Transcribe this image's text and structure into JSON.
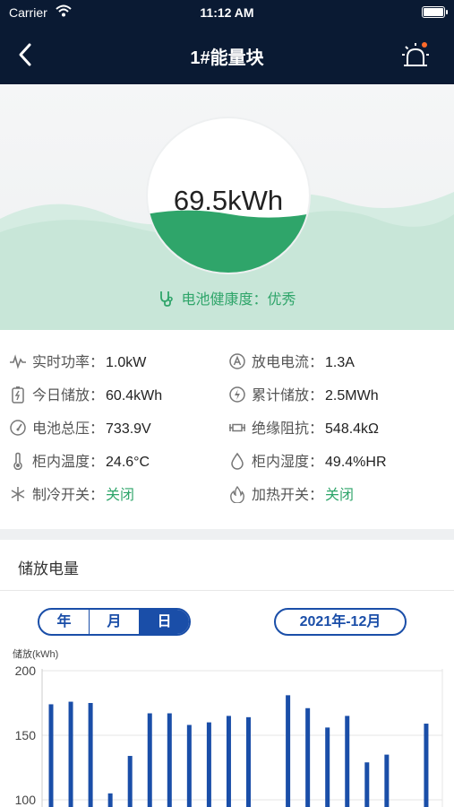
{
  "status_bar": {
    "carrier": "Carrier",
    "time": "11:12 AM"
  },
  "nav": {
    "title": "1#能量块"
  },
  "hero": {
    "energy_value": "69.5kWh",
    "fill_fraction": 0.38,
    "health_text": "电池健康度：优秀"
  },
  "metrics": [
    {
      "icon": "pulse-icon",
      "label": "实时功率：",
      "value": "1.0kW"
    },
    {
      "icon": "ampere-icon",
      "label": "放电电流：",
      "value": "1.3A"
    },
    {
      "icon": "battery-charge-icon",
      "label": "今日储放：",
      "value": "60.4kWh"
    },
    {
      "icon": "cumulative-icon",
      "label": "累计储放：",
      "value": "2.5MWh"
    },
    {
      "icon": "gauge-icon",
      "label": "电池总压：",
      "value": "733.9V"
    },
    {
      "icon": "resistor-icon",
      "label": "绝缘阻抗：",
      "value": "548.4kΩ"
    },
    {
      "icon": "thermometer-icon",
      "label": "柜内温度：",
      "value": "24.6°C"
    },
    {
      "icon": "droplet-icon",
      "label": "柜内湿度：",
      "value": "49.4%HR"
    },
    {
      "icon": "snowflake-icon",
      "label": "制冷开关：",
      "value": "关闭"
    },
    {
      "icon": "flame-icon",
      "label": "加热开关：",
      "value": "关闭"
    }
  ],
  "chart_section": {
    "title": "储放电量",
    "tabs": [
      "年",
      "月",
      "日"
    ],
    "active_tab": "日",
    "date": "2021年-12月"
  },
  "chart_data": {
    "type": "bar",
    "ylabel": "储放(kWh)",
    "yticks": [
      100,
      150,
      200
    ],
    "ylim": [
      100,
      200
    ],
    "grid": true,
    "bar_color": "#1a4ea8",
    "values": [
      174,
      176,
      175,
      105,
      134,
      167,
      167,
      158,
      160,
      165,
      164,
      null,
      181,
      171,
      156,
      165,
      129,
      135,
      null,
      159
    ]
  },
  "colors": {
    "navy": "#0a1a33",
    "green": "#2fa56a",
    "blue": "#1a4ea8"
  }
}
